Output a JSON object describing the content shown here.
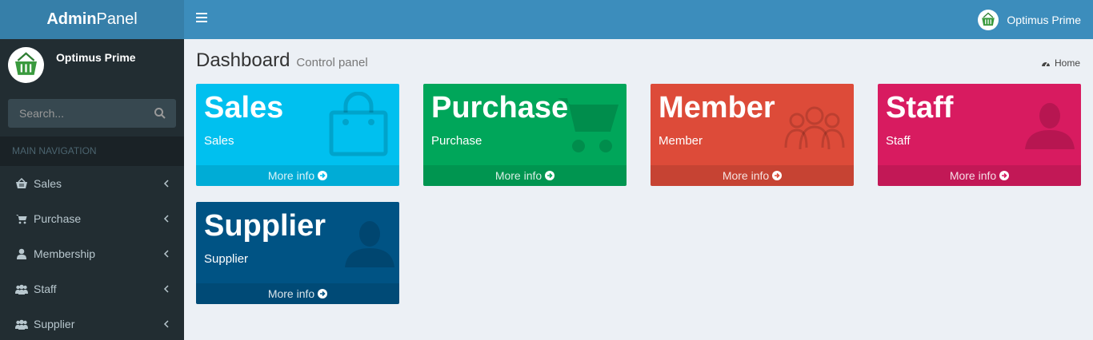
{
  "brand": {
    "bold": "Admin",
    "regular": "Panel"
  },
  "user": {
    "name": "Optimus Prime"
  },
  "search": {
    "placeholder": "Search..."
  },
  "sidebar": {
    "header": "MAIN NAVIGATION",
    "items": [
      {
        "label": "Sales",
        "icon": "basket-icon"
      },
      {
        "label": "Purchase",
        "icon": "cart-icon"
      },
      {
        "label": "Membership",
        "icon": "user-icon"
      },
      {
        "label": "Staff",
        "icon": "users-icon"
      },
      {
        "label": "Supplier",
        "icon": "users-icon"
      }
    ]
  },
  "page": {
    "title": "Dashboard",
    "subtitle": "Control panel",
    "breadcrumb": "Home"
  },
  "boxes": [
    {
      "title": "Sales",
      "sub": "Sales",
      "more": "More info",
      "color": "#00c0ef",
      "icon": "shopping-bag-icon"
    },
    {
      "title": "Purchase",
      "sub": "Purchase",
      "more": "More info",
      "color": "#00a65a",
      "icon": "cart-icon"
    },
    {
      "title": "Member",
      "sub": "Member",
      "more": "More info",
      "color": "#dd4b39",
      "icon": "users-icon"
    },
    {
      "title": "Staff",
      "sub": "Staff",
      "more": "More info",
      "color": "#d81b60",
      "icon": "user-icon"
    },
    {
      "title": "Supplier",
      "sub": "Supplier",
      "more": "More info",
      "color": "#005384",
      "icon": "user-icon"
    }
  ],
  "colors": {
    "header": "#3c8dbc",
    "logo": "#367fa9",
    "sidebar": "#222d32",
    "content": "#ecf0f5"
  }
}
